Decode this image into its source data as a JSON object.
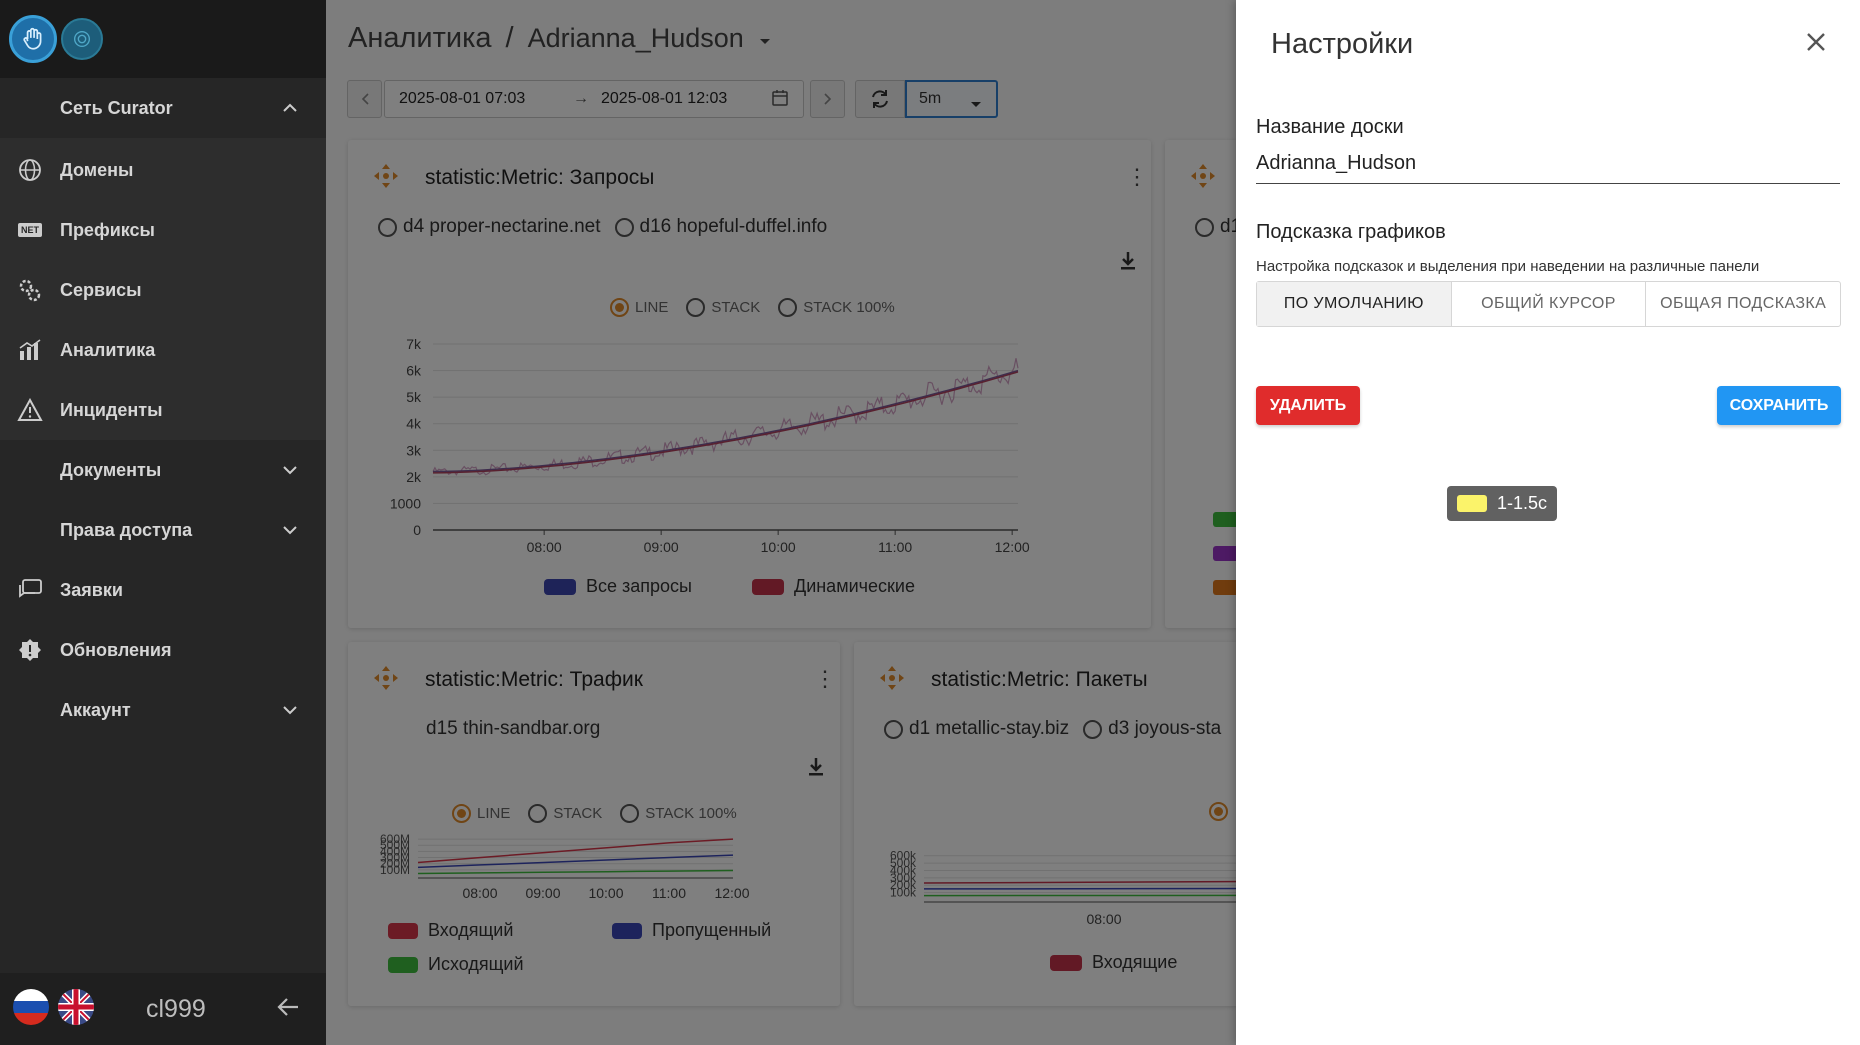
{
  "sidebar": {
    "items": [
      {
        "label": "Сеть Curator",
        "icon": "chevron-up-icon"
      },
      {
        "label": "Домены",
        "icon": "globe-icon"
      },
      {
        "label": "Префиксы",
        "icon": "net-icon"
      },
      {
        "label": "Сервисы",
        "icon": "gears-icon"
      },
      {
        "label": "Аналитика",
        "icon": "chart-icon"
      },
      {
        "label": "Инциденты",
        "icon": "warning-icon"
      },
      {
        "label": "Документы",
        "icon": "chevron-down-icon"
      },
      {
        "label": "Права доступа",
        "icon": "chevron-down-icon"
      },
      {
        "label": "Заявки",
        "icon": "chat-icon"
      },
      {
        "label": "Обновления",
        "icon": "badge-icon"
      },
      {
        "label": "Аккаунт",
        "icon": "chevron-down-icon"
      }
    ],
    "net_icon_text": "NET",
    "user": "cl999"
  },
  "header": {
    "section": "Аналитика",
    "separator": "/",
    "board": "Adrianna_Hudson"
  },
  "toolbar": {
    "date_from": "2025-08-01 07:03",
    "arrow": "→",
    "date_to": "2025-08-01 12:03",
    "interval": "5m"
  },
  "cards": {
    "requests": {
      "title": "statistic:Metric: Запросы",
      "domains": [
        "d4 proper-nectarine.net",
        "d16 hopeful-duffel.info"
      ],
      "modes": [
        "LINE",
        "STACK",
        "STACK 100%"
      ],
      "legend": [
        {
          "label": "Все запросы",
          "color": "#3d47b0"
        },
        {
          "label": "Динамические",
          "color": "#c4324a"
        }
      ]
    },
    "traffic": {
      "title": "statistic:Metric: Трафик",
      "domain": "d15 thin-sandbar.org",
      "modes": [
        "LINE",
        "STACK",
        "STACK 100%"
      ],
      "legend": [
        {
          "label": "Входящий",
          "color": "#d9364a"
        },
        {
          "label": "Пропущенный",
          "color": "#3a47b8"
        },
        {
          "label": "Исходящий",
          "color": "#3fbf3f"
        }
      ]
    },
    "packets": {
      "title": "statistic:Metric: Пакеты",
      "domains": [
        "d1 metallic-stay.biz",
        "d3 joyous-sta"
      ],
      "legend": [
        {
          "label": "Входящие",
          "color": "#c4324a"
        }
      ]
    },
    "partial": {
      "domain_fragment": "d1"
    }
  },
  "chart_data": [
    {
      "type": "line",
      "title": "statistic:Metric: Запросы",
      "x": [
        "08:00",
        "09:00",
        "10:00",
        "11:00",
        "12:00"
      ],
      "yticks": [
        "0",
        "1000",
        "2k",
        "3k",
        "4k",
        "5k",
        "6k",
        "7k"
      ],
      "ylim": [
        0,
        7000
      ],
      "series": [
        {
          "name": "Все запросы",
          "points": [
            [
              7.05,
              2200
            ],
            [
              8.0,
              2400
            ],
            [
              9.0,
              2900
            ],
            [
              10.0,
              3800
            ],
            [
              11.0,
              4900
            ],
            [
              12.05,
              6000
            ]
          ]
        },
        {
          "name": "Динамические",
          "points": [
            [
              7.05,
              2150
            ],
            [
              8.0,
              2350
            ],
            [
              9.0,
              2850
            ],
            [
              10.0,
              3750
            ],
            [
              11.0,
              4850
            ],
            [
              12.05,
              5950
            ]
          ]
        }
      ]
    },
    {
      "type": "line",
      "title": "statistic:Metric: Трафик",
      "x": [
        "08:00",
        "09:00",
        "10:00",
        "11:00",
        "12:00"
      ],
      "yticks": [
        "100M",
        "200M",
        "300M",
        "400M",
        "500M",
        "600M"
      ],
      "series": [
        {
          "name": "Входящий",
          "values": [
            220,
            300,
            380,
            460,
            540,
            600
          ]
        },
        {
          "name": "Пропущенный",
          "values": [
            140,
            180,
            220,
            260,
            300,
            340
          ]
        },
        {
          "name": "Исходящий",
          "values": [
            40,
            50,
            60,
            70,
            80,
            90
          ]
        }
      ]
    },
    {
      "type": "line",
      "title": "statistic:Metric: Пакеты",
      "x": [
        "08:00"
      ],
      "yticks": [
        "100k",
        "200k",
        "300k",
        "400k",
        "500k",
        "600k"
      ],
      "series": [
        {
          "name": "Входящие",
          "values": [
            230,
            240,
            250,
            270,
            290
          ]
        }
      ]
    }
  ],
  "panel": {
    "title": "Настройки",
    "board_name_label": "Название доски",
    "board_name_value": "Adrianna_Hudson",
    "tooltip_label": "Подсказка графиков",
    "tooltip_hint": "Настройка подсказок и выделения при наведении на различные панели",
    "modes": [
      "ПО УМОЛЧАНИЮ",
      "ОБЩИЙ КУРСОР",
      "ОБЩАЯ ПОДСКАЗКА"
    ],
    "delete": "УДАЛИТЬ",
    "save": "СОХРАНИТЬ"
  },
  "floating_tooltip": {
    "label": "1-1.5с",
    "color": "#fbf36a"
  }
}
